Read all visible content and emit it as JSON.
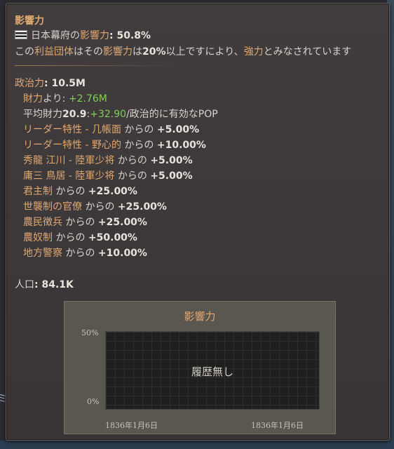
{
  "tooltip": {
    "title": "影響力",
    "flag_icon": "japan-shogunate-flag",
    "country_prefix": "日本幕府",
    "country_mid": "の",
    "country_hl": "影響力",
    "country_value": ": 50.8%",
    "note_a": "この",
    "note_hl1": "利益団体",
    "note_b": "はその",
    "note_hl2": "影響力",
    "note_c": "は",
    "note_bold": "20%",
    "note_d": "以上ですにより、",
    "note_hl3": "強力",
    "note_e": "とみなされています",
    "clout_label": "政治力",
    "clout_value": ": 10.5M",
    "wealth_label": "財力",
    "wealth_mid": "より: ",
    "wealth_value": "+2.76M",
    "avg_a": "平均財力",
    "avg_val": "20.9",
    "avg_colon": ":",
    "avg_plus": "+32.90",
    "avg_rest": "/政治的に有効なPOP",
    "modifiers": [
      {
        "name": "リーダー特性 - 几帳面",
        "from": " からの ",
        "value": "+5.00%"
      },
      {
        "name": "リーダー特性 - 野心的",
        "from": " からの ",
        "value": "+10.00%"
      },
      {
        "name": "秀龍 江川 - 陸軍少将",
        "from": " からの ",
        "value": "+5.00%"
      },
      {
        "name": "庸三 鳥居 - 陸軍少将",
        "from": " からの ",
        "value": "+5.00%"
      },
      {
        "name": "君主制",
        "from": " からの ",
        "value": "+25.00%"
      },
      {
        "name": "世襲制の官僚",
        "from": " からの ",
        "value": "+25.00%"
      },
      {
        "name": "農民徴兵",
        "from": " からの ",
        "value": "+25.00%"
      },
      {
        "name": "農奴制",
        "from": " からの ",
        "value": "+50.00%"
      },
      {
        "name": "地方警察",
        "from": " からの ",
        "value": "+10.00%"
      }
    ],
    "pop_label": "人口",
    "pop_value": ": 84.1K"
  },
  "chart": {
    "title": "影響力",
    "empty_text": "履歴無し",
    "y_top": "50%",
    "y_bottom": "0%",
    "x_left": "1836年1月6日",
    "x_right": "1836年1月6日"
  },
  "colors": {
    "accent": "#e0a870",
    "positive": "#7fcf5a"
  }
}
